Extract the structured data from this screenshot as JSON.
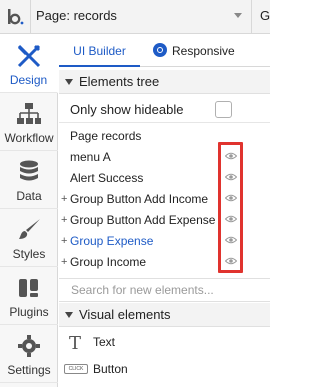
{
  "topbar": {
    "page_label": "Page: records",
    "cut_text": "G"
  },
  "sidebar": {
    "items": [
      {
        "label": "Design",
        "icon": "design-icon"
      },
      {
        "label": "Workflow",
        "icon": "workflow-icon"
      },
      {
        "label": "Data",
        "icon": "database-icon"
      },
      {
        "label": "Styles",
        "icon": "brush-icon"
      },
      {
        "label": "Plugins",
        "icon": "plugin-icon"
      },
      {
        "label": "Settings",
        "icon": "gear-icon"
      }
    ]
  },
  "tabs": {
    "builder": "UI Builder",
    "responsive": "Responsive"
  },
  "elements_tree": {
    "title": "Elements tree",
    "only_hideable_label": "Only show hideable",
    "rows": [
      {
        "name": "Page records",
        "expand": "",
        "eye": false,
        "highlight": false
      },
      {
        "name": "menu A",
        "expand": "",
        "eye": true,
        "highlight": false
      },
      {
        "name": "Alert Success",
        "expand": "",
        "eye": true,
        "highlight": false
      },
      {
        "name": "Group Button Add Income",
        "expand": "+",
        "eye": true,
        "highlight": false
      },
      {
        "name": "Group Button Add Expense",
        "expand": "+",
        "eye": true,
        "highlight": false
      },
      {
        "name": "Group Expense",
        "expand": "+",
        "eye": true,
        "highlight": true
      },
      {
        "name": "Group Income",
        "expand": "+",
        "eye": true,
        "highlight": false
      }
    ]
  },
  "search": {
    "placeholder": "Search for new elements..."
  },
  "visual_elements": {
    "title": "Visual elements",
    "items": [
      {
        "name": "Text",
        "icon": "text-icon"
      },
      {
        "name": "Button",
        "icon": "button-icon",
        "icon_text": "CLICK"
      }
    ]
  },
  "colors": {
    "accent": "#1e5bc6",
    "highlight_box": "#e0332e"
  }
}
